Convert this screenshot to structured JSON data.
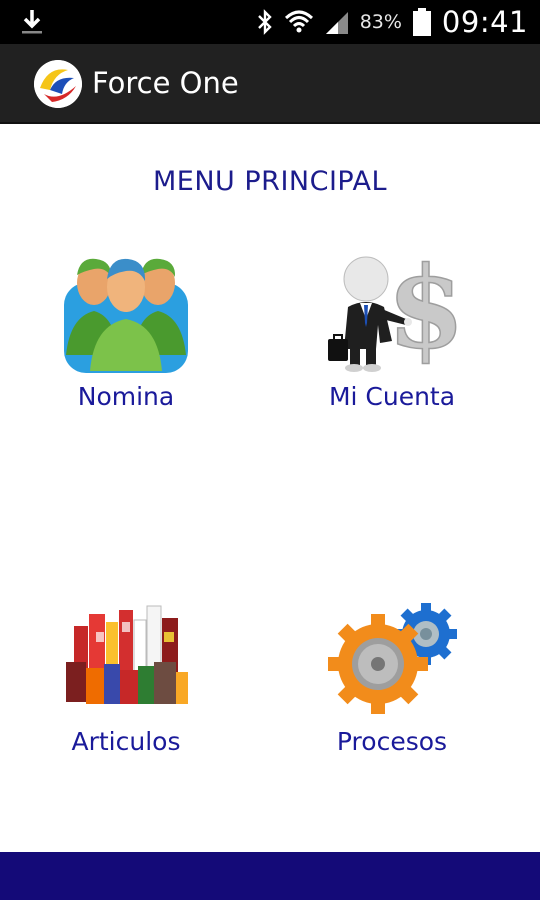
{
  "status_bar": {
    "battery_percent": "83%",
    "time": "09:41",
    "icons": [
      "download-icon",
      "bluetooth-icon",
      "wifi-icon",
      "signal-icon",
      "battery-icon"
    ]
  },
  "app_bar": {
    "title": "Force One",
    "logo_icon": "force-one-logo"
  },
  "main": {
    "title": "MENU PRINCIPAL",
    "items": [
      {
        "label": "Nomina",
        "icon": "people-group-icon"
      },
      {
        "label": "Mi Cuenta",
        "icon": "businessman-dollar-icon"
      },
      {
        "label": "Articulos",
        "icon": "products-icon"
      },
      {
        "label": "Procesos",
        "icon": "gears-icon"
      }
    ]
  },
  "colors": {
    "status_bar": "#000000",
    "app_bar": "#212121",
    "menu_text": "#1a1a9a",
    "bottom_bar": "#140a78"
  }
}
